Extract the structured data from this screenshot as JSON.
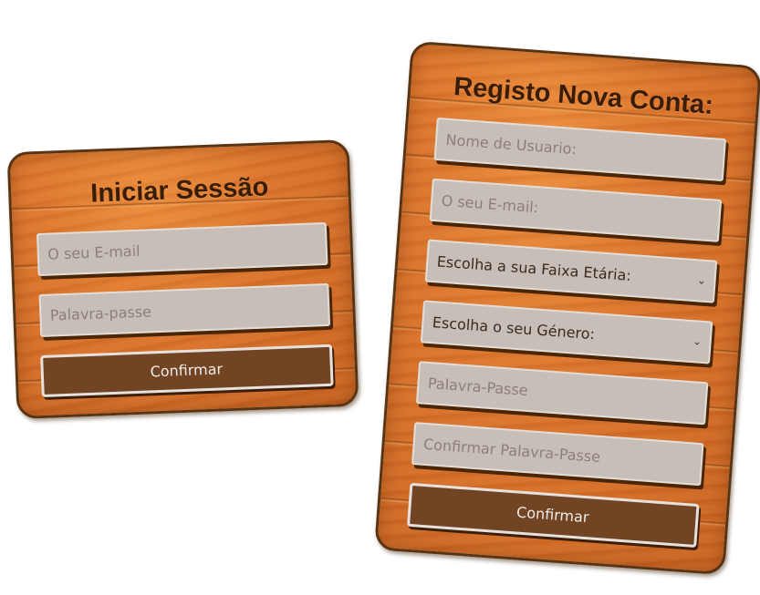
{
  "login": {
    "title": "Iniciar Sessão",
    "email_placeholder": "O seu E-mail",
    "password_placeholder": "Palavra-passe",
    "confirm_label": "Confirmar"
  },
  "register": {
    "title": "Registo Nova Conta:",
    "username_placeholder": "Nome de Usuario:",
    "email_placeholder": "O seu E-mail:",
    "age_select_label": "Escolha a sua Faixa Etária:",
    "gender_select_label": "Escolha o seu Género:",
    "password_placeholder": "Palavra-Passe",
    "confirm_password_placeholder": "Confirmar Palavra-Passe",
    "confirm_label": "Confirmar"
  },
  "icons": {
    "select_arrow": "chevron-down-icon"
  },
  "colors": {
    "wood": "#d8702a",
    "wood_border": "#5a3412",
    "title_text": "#3a1d06",
    "field_bg": "#c7beb7",
    "button_bg": "#714423"
  }
}
